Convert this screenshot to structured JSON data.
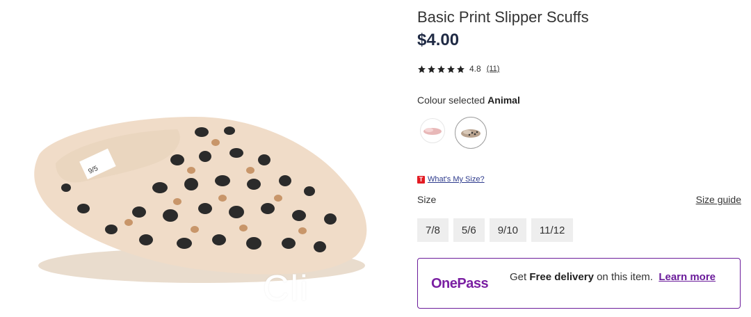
{
  "product": {
    "title": "Basic Print Slipper Scuffs",
    "price": "$4.00",
    "rating": {
      "stars": 5,
      "value": "4.8",
      "count": "(11)"
    },
    "colour": {
      "label": "Colour selected",
      "selected": "Animal"
    },
    "swatches": [
      {
        "name": "Pink",
        "color": "#e8b8b8"
      },
      {
        "name": "Animal",
        "color": "#a88f7a"
      }
    ],
    "image_overlay_text": "Cli"
  },
  "sizing": {
    "badge": "T",
    "whats_my_size": "What's My Size?",
    "size_label": "Size",
    "size_guide": "Size guide",
    "options": [
      "7/8",
      "5/6",
      "9/10",
      "11/12"
    ]
  },
  "onepass": {
    "logo": "OnePass",
    "text_prefix": "Get ",
    "text_bold": "Free delivery",
    "text_suffix": " on this item.",
    "learn_more": "Learn more",
    "accent": "#6a1b9a"
  }
}
